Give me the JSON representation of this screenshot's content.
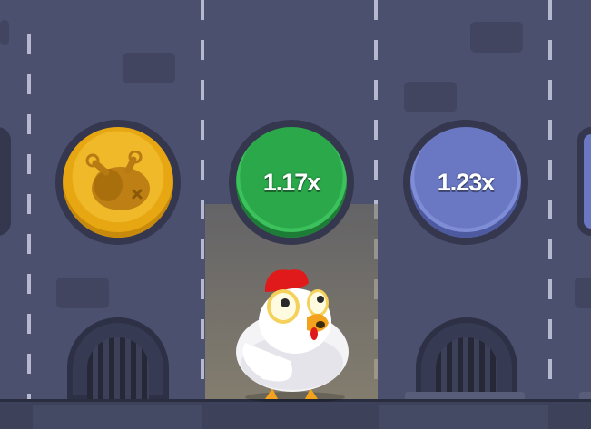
{
  "lanes": [
    {
      "id": "lane-1",
      "state": "collected",
      "icon": "roast-chicken-icon",
      "accent": "#f0b92a"
    },
    {
      "id": "lane-2",
      "state": "current",
      "multiplier": "1.17x",
      "accent": "#2aa84a"
    },
    {
      "id": "lane-3",
      "state": "next",
      "multiplier": "1.23x",
      "accent": "#6a78c4"
    }
  ],
  "player": {
    "icon": "chicken-icon"
  },
  "colors": {
    "background": "#4b506f",
    "lane_divider": "#c9cbe0",
    "ground": "#3d4159"
  }
}
